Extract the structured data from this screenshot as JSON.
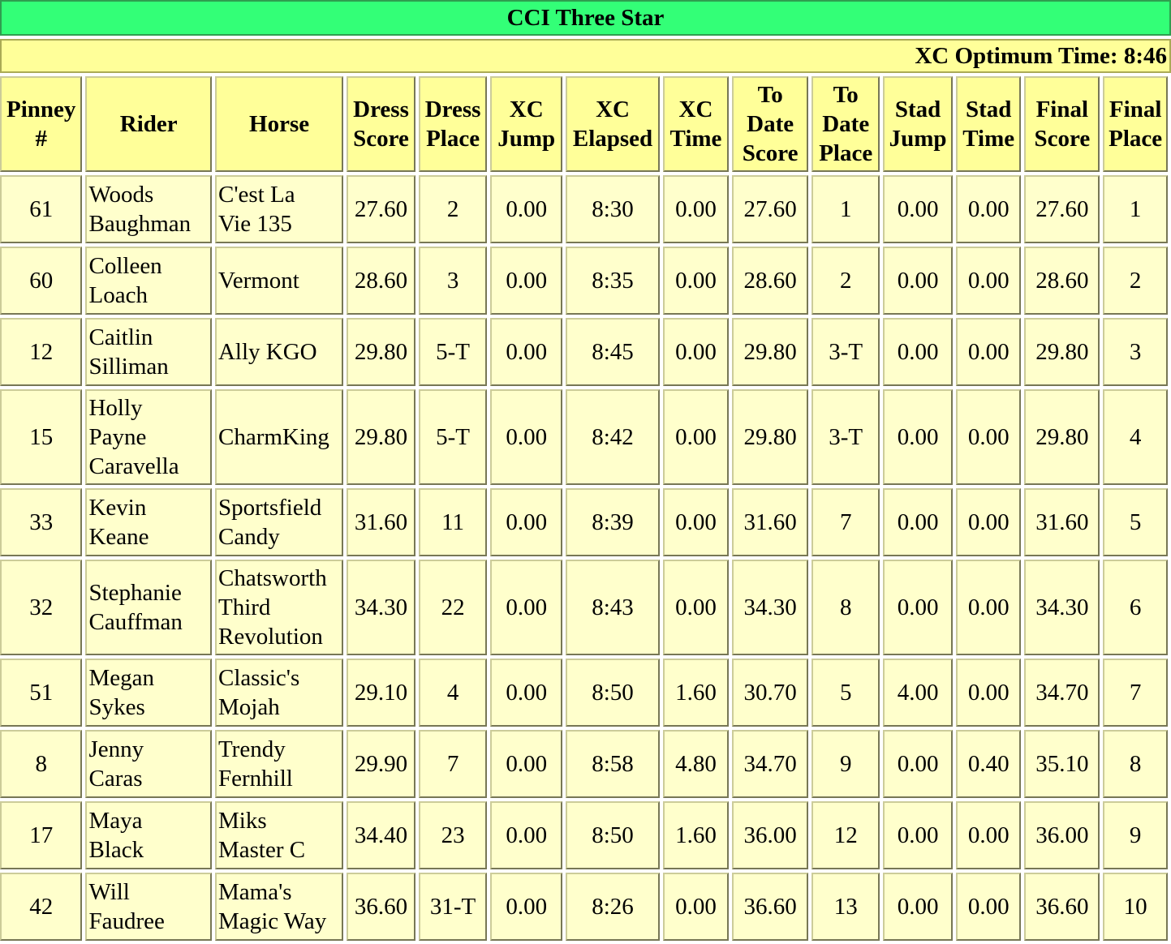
{
  "title": "CCI Three Star",
  "optimum_time": "XC Optimum Time: 8:46",
  "columns": [
    "Pinney\n#",
    "Rider",
    "Horse",
    "Dress\nScore",
    "Dress\nPlace",
    "XC\nJump",
    "XC\nElapsed",
    "XC\nTime",
    "To\nDate\nScore",
    "To\nDate\nPlace",
    "Stad\nJump",
    "Stad\nTime",
    "Final\nScore",
    "Final\nPlace"
  ],
  "rows": [
    [
      "61",
      "Woods\nBaughman",
      "C'est La\nVie 135",
      "27.60",
      "2",
      "0.00",
      "8:30",
      "0.00",
      "27.60",
      "1",
      "0.00",
      "0.00",
      "27.60",
      "1"
    ],
    [
      "60",
      "Colleen\nLoach",
      "Vermont",
      "28.60",
      "3",
      "0.00",
      "8:35",
      "0.00",
      "28.60",
      "2",
      "0.00",
      "0.00",
      "28.60",
      "2"
    ],
    [
      "12",
      "Caitlin\nSilliman",
      "Ally KGO",
      "29.80",
      "5-T",
      "0.00",
      "8:45",
      "0.00",
      "29.80",
      "3-T",
      "0.00",
      "0.00",
      "29.80",
      "3"
    ],
    [
      "15",
      "Holly\nPayne\nCaravella",
      "CharmKing",
      "29.80",
      "5-T",
      "0.00",
      "8:42",
      "0.00",
      "29.80",
      "3-T",
      "0.00",
      "0.00",
      "29.80",
      "4"
    ],
    [
      "33",
      "Kevin\nKeane",
      "Sportsfield\nCandy",
      "31.60",
      "11",
      "0.00",
      "8:39",
      "0.00",
      "31.60",
      "7",
      "0.00",
      "0.00",
      "31.60",
      "5"
    ],
    [
      "32",
      "Stephanie\nCauffman",
      "Chatsworth\nThird\nRevolution",
      "34.30",
      "22",
      "0.00",
      "8:43",
      "0.00",
      "34.30",
      "8",
      "0.00",
      "0.00",
      "34.30",
      "6"
    ],
    [
      "51",
      "Megan\nSykes",
      "Classic's\nMojah",
      "29.10",
      "4",
      "0.00",
      "8:50",
      "1.60",
      "30.70",
      "5",
      "4.00",
      "0.00",
      "34.70",
      "7"
    ],
    [
      "8",
      "Jenny\nCaras",
      "Trendy\nFernhill",
      "29.90",
      "7",
      "0.00",
      "8:58",
      "4.80",
      "34.70",
      "9",
      "0.00",
      "0.40",
      "35.10",
      "8"
    ],
    [
      "17",
      "Maya\nBlack",
      "Miks\nMaster C",
      "34.40",
      "23",
      "0.00",
      "8:50",
      "1.60",
      "36.00",
      "12",
      "0.00",
      "0.00",
      "36.00",
      "9"
    ],
    [
      "42",
      "Will\nFaudree",
      "Mama's\nMagic Way",
      "36.60",
      "31-T",
      "0.00",
      "8:26",
      "0.00",
      "36.60",
      "13",
      "0.00",
      "0.00",
      "36.60",
      "10"
    ]
  ]
}
